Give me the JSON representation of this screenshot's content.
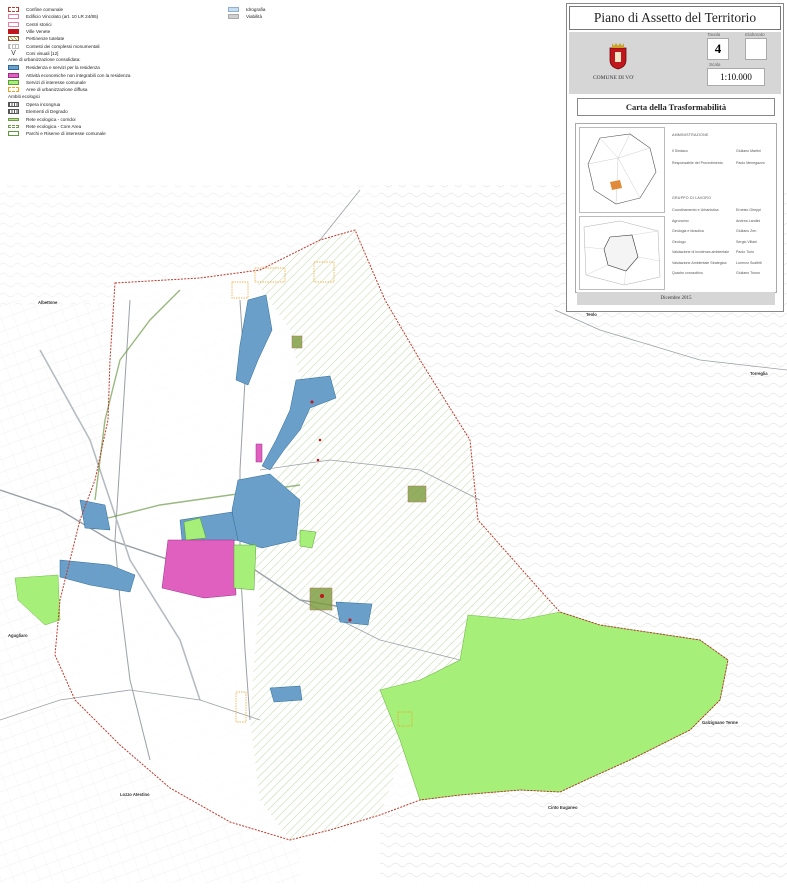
{
  "legend": {
    "col1": [
      {
        "label": "Confine comunale",
        "swatch": "dash",
        "name": "legend-municipal-boundary"
      },
      {
        "label": "Edificio Vincolato (art. 10 LR 24/85)",
        "swatch": "pink",
        "name": "legend-listed-building"
      },
      {
        "label": "Centri storici",
        "swatch": "pink",
        "name": "legend-historic-centres"
      },
      {
        "label": "Ville Venete",
        "swatch": "red",
        "name": "legend-ville-venete"
      },
      {
        "label": "Pertinenze tutelate",
        "swatch": "hatch",
        "name": "legend-protected-grounds"
      },
      {
        "label": "Contesti dei complessi monumentali",
        "swatch": "grid",
        "name": "legend-monumental-contexts"
      },
      {
        "label": "Coni visuali [12]",
        "swatch": "v",
        "name": "legend-view-cones"
      },
      {
        "label": "Aree di urbanizzazione consolidata:",
        "swatch": "head",
        "name": "legend-consolidated-heading"
      },
      {
        "label": "Residenza e servizi per la residenza",
        "swatch": "blue",
        "name": "legend-residential"
      },
      {
        "label": "Attività economiche non integrabili con la residenza",
        "swatch": "mag",
        "name": "legend-economic"
      },
      {
        "label": "Servizi di interesse comunale",
        "swatch": "green",
        "name": "legend-municipal-services"
      },
      {
        "label": "Aree di urbanizzazione diffusa",
        "swatch": "orange",
        "name": "legend-diffuse-urbanisation"
      },
      {
        "label": "Ambiti ecologici",
        "swatch": "head",
        "name": "legend-ecological-heading"
      },
      {
        "label": "Opera incongrua",
        "swatch": "ladder",
        "name": "legend-incongruous-work"
      },
      {
        "label": "Elementi di Degrado",
        "swatch": "ladder",
        "name": "legend-degradation"
      },
      {
        "label": "Rete ecologica - corridoi",
        "swatch": "eco",
        "name": "legend-eco-corridors"
      },
      {
        "label": "Rete ecologica - Core Area",
        "swatch": "eco2",
        "name": "legend-eco-core-area"
      },
      {
        "label": "Parchi e Riserve di interesse comunale",
        "swatch": "park",
        "name": "legend-parks"
      }
    ],
    "col2": [
      {
        "label": "Idrografia",
        "swatch": "hydro",
        "name": "legend-hydrography"
      },
      {
        "label": "Viabilità",
        "swatch": "road",
        "name": "legend-roads"
      }
    ]
  },
  "titleblock": {
    "title": "Piano di Assetto del Territorio",
    "comune": "COMUNE DI VO'",
    "tavola_label": "Tavola",
    "tavola": "4",
    "elaborato_label": "Elaborato",
    "scala_label": "Scala",
    "scala": "1:10.000",
    "subtitle": "Carta della Trasformabilità",
    "admin_heading": "AMMINISTRAZIONE",
    "admin": [
      {
        "role": "Il Sindaco",
        "name": "Giuliano Martini"
      },
      {
        "role": "Responsabile del Procedimento",
        "name": "Paolo Menegazzo"
      }
    ],
    "team_heading": "GRUPPO DI LAVORO",
    "team": [
      {
        "role": "Coordinamento e Urbanistica",
        "name": "Ernesto Gheppi"
      },
      {
        "role": "Agronomo",
        "name": "Andrea Landini"
      },
      {
        "role": "Geologia e idraulica",
        "name": "Giuliano Zen"
      },
      {
        "role": "Geologo",
        "name": "Sergio Villani"
      },
      {
        "role": "Valutazione di incidenza ambientale",
        "name": "Paolo Turin"
      },
      {
        "role": "Valutazione Ambientale Strategica",
        "name": "Lorenzo Scaltriti"
      },
      {
        "role": "Quadro conoscitivo",
        "name": "Giuliano Tonon"
      }
    ],
    "date": "Dicembre 2015"
  },
  "places": {
    "albettone": "Albettone",
    "teolo": "Teolo",
    "torreglia": "Torreglia",
    "agugliaro": "Agugliaro",
    "galzignano": "Galzignano Terme",
    "lozzo": "Lozzo Atestino",
    "cinto": "Cinto Euganeo"
  },
  "colors": {
    "residential": "#6a9fc9",
    "economic": "#e060c0",
    "services": "#a6f07a",
    "boundary": "#c0392b",
    "hatch": "#8fbf6a",
    "roads": "#9aa0a6"
  }
}
